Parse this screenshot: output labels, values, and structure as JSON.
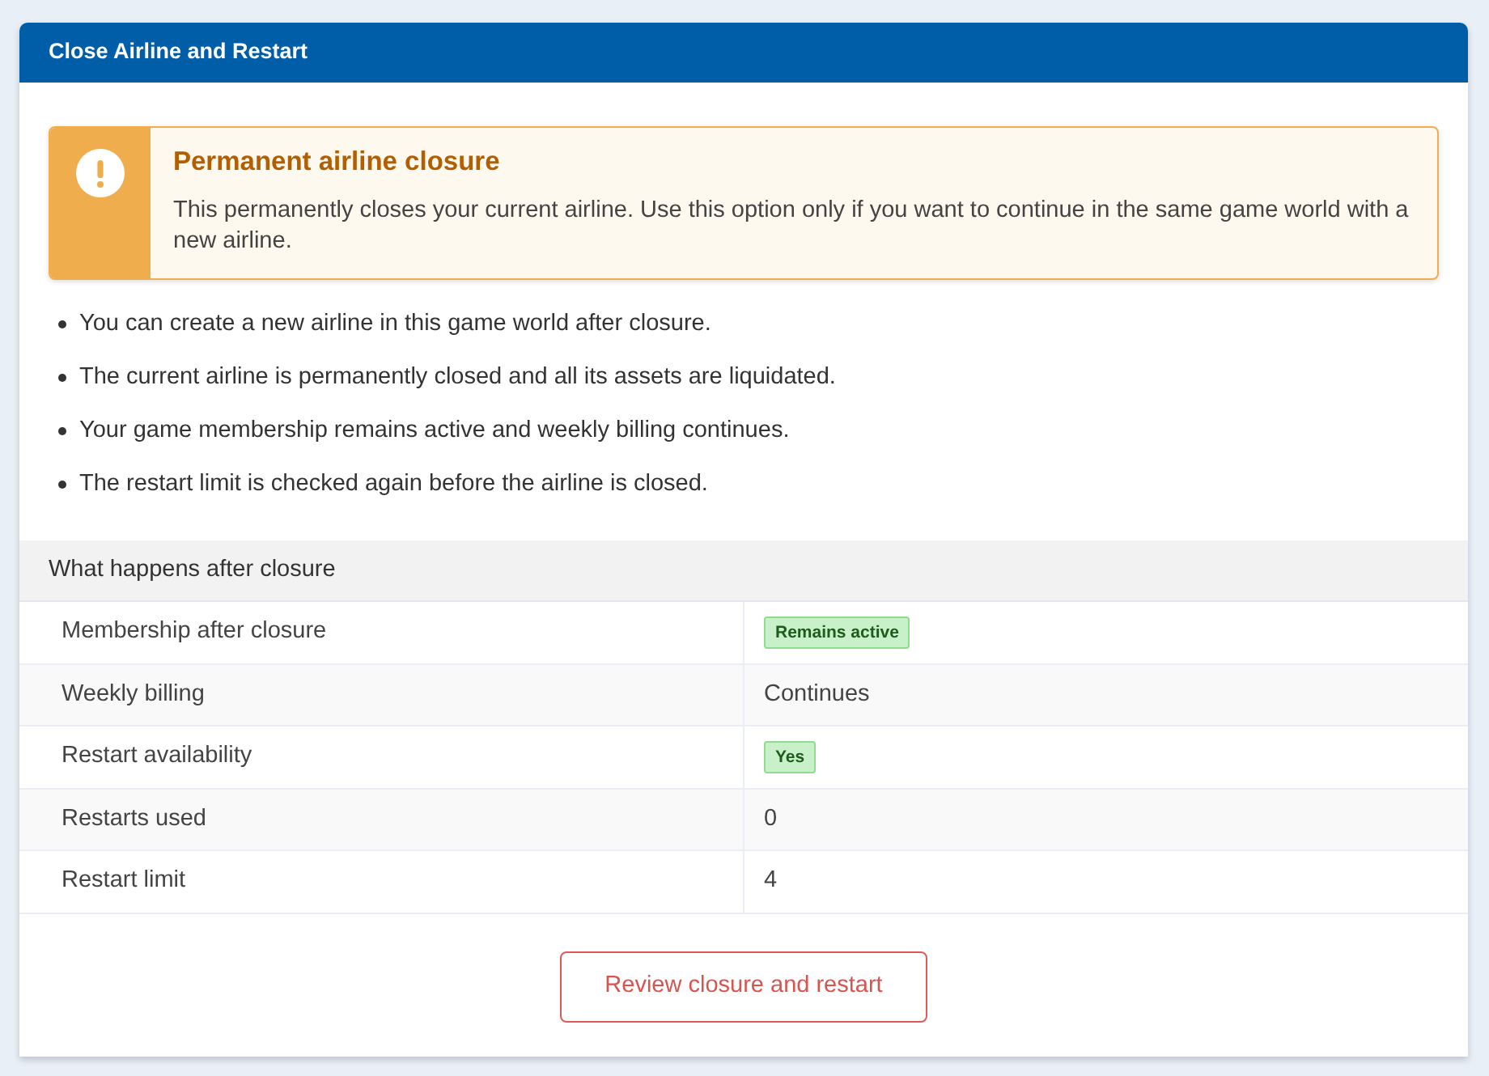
{
  "window": {
    "title": "Close Airline and Restart"
  },
  "alert": {
    "title": "Permanent airline closure",
    "text": "This permanently closes your current airline. Use this option only if you want to continue in the same game world with a new airline."
  },
  "bullets": [
    "You can create a new airline in this game world after closure.",
    "The current airline is permanently closed and all its assets are liquidated.",
    "Your game membership remains active and weekly billing continues.",
    "The restart limit is checked again before the airline is closed."
  ],
  "details": {
    "title": "What happens after closure",
    "rows": [
      {
        "label": "Membership after closure",
        "value": "Remains active",
        "kind": "badge"
      },
      {
        "label": "Weekly billing",
        "value": "Continues",
        "kind": "text"
      },
      {
        "label": "Restart availability",
        "value": "Yes",
        "kind": "badge"
      },
      {
        "label": "Restarts used",
        "value": "0",
        "kind": "text"
      },
      {
        "label": "Restart limit",
        "value": "4",
        "kind": "text"
      }
    ]
  },
  "button": {
    "label": "Review closure and restart"
  }
}
